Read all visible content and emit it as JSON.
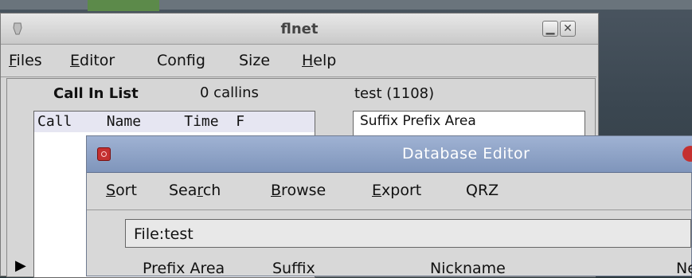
{
  "flnet": {
    "title": "flnet",
    "menu": [
      {
        "label": "Files",
        "mnemonic": "F",
        "rest": "iles"
      },
      {
        "label": "Editor",
        "mnemonic": "E",
        "rest": "ditor"
      },
      {
        "label": "Config",
        "mnemonic": "",
        "rest": "Config"
      },
      {
        "label": "Size",
        "mnemonic": "",
        "rest": "Size"
      },
      {
        "label": "Help",
        "mnemonic": "H",
        "rest": "elp"
      }
    ],
    "callin_title": "Call In List",
    "callin_count": "0 callins",
    "db_label": "test (1108)",
    "callin_header": "Call    Name     Time  F",
    "suffix_header": "Suffix Prefix Area"
  },
  "dbeditor": {
    "title": "Database Editor",
    "menu": [
      {
        "label": "Sort",
        "pre": "",
        "mnemonic": "S",
        "post": "ort"
      },
      {
        "label": "Search",
        "pre": "Sea",
        "mnemonic": "r",
        "post": "ch"
      },
      {
        "label": "Browse",
        "pre": "",
        "mnemonic": "B",
        "post": "rowse"
      },
      {
        "label": "Export",
        "pre": "",
        "mnemonic": "E",
        "post": "xport"
      },
      {
        "label": "QRZ",
        "pre": "QRZ",
        "mnemonic": "",
        "post": ""
      }
    ],
    "file_label": "File:test",
    "columns": [
      "Prefix Area",
      "Suffix",
      "Nickname",
      "Ne"
    ]
  },
  "colors": {
    "window_bg": "#d6d6d6",
    "db_titlebar": "#8fa3c7",
    "list_header": "#e6e6f2"
  }
}
